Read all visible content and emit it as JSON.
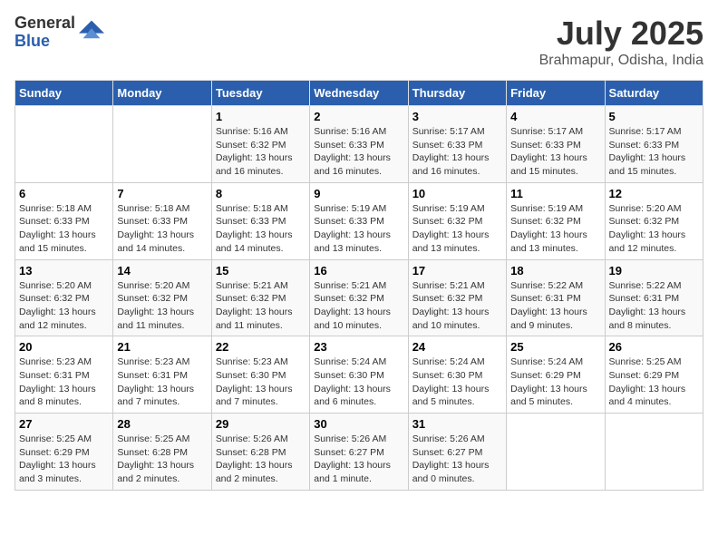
{
  "logo": {
    "general": "General",
    "blue": "Blue"
  },
  "title": "July 2025",
  "location": "Brahmapur, Odisha, India",
  "weekdays": [
    "Sunday",
    "Monday",
    "Tuesday",
    "Wednesday",
    "Thursday",
    "Friday",
    "Saturday"
  ],
  "weeks": [
    [
      {
        "day": null,
        "detail": null
      },
      {
        "day": null,
        "detail": null
      },
      {
        "day": "1",
        "sunrise": "5:16 AM",
        "sunset": "6:32 PM",
        "daylight": "13 hours and 16 minutes."
      },
      {
        "day": "2",
        "sunrise": "5:16 AM",
        "sunset": "6:33 PM",
        "daylight": "13 hours and 16 minutes."
      },
      {
        "day": "3",
        "sunrise": "5:17 AM",
        "sunset": "6:33 PM",
        "daylight": "13 hours and 16 minutes."
      },
      {
        "day": "4",
        "sunrise": "5:17 AM",
        "sunset": "6:33 PM",
        "daylight": "13 hours and 15 minutes."
      },
      {
        "day": "5",
        "sunrise": "5:17 AM",
        "sunset": "6:33 PM",
        "daylight": "13 hours and 15 minutes."
      }
    ],
    [
      {
        "day": "6",
        "sunrise": "5:18 AM",
        "sunset": "6:33 PM",
        "daylight": "13 hours and 15 minutes."
      },
      {
        "day": "7",
        "sunrise": "5:18 AM",
        "sunset": "6:33 PM",
        "daylight": "13 hours and 14 minutes."
      },
      {
        "day": "8",
        "sunrise": "5:18 AM",
        "sunset": "6:33 PM",
        "daylight": "13 hours and 14 minutes."
      },
      {
        "day": "9",
        "sunrise": "5:19 AM",
        "sunset": "6:33 PM",
        "daylight": "13 hours and 13 minutes."
      },
      {
        "day": "10",
        "sunrise": "5:19 AM",
        "sunset": "6:32 PM",
        "daylight": "13 hours and 13 minutes."
      },
      {
        "day": "11",
        "sunrise": "5:19 AM",
        "sunset": "6:32 PM",
        "daylight": "13 hours and 13 minutes."
      },
      {
        "day": "12",
        "sunrise": "5:20 AM",
        "sunset": "6:32 PM",
        "daylight": "13 hours and 12 minutes."
      }
    ],
    [
      {
        "day": "13",
        "sunrise": "5:20 AM",
        "sunset": "6:32 PM",
        "daylight": "13 hours and 12 minutes."
      },
      {
        "day": "14",
        "sunrise": "5:20 AM",
        "sunset": "6:32 PM",
        "daylight": "13 hours and 11 minutes."
      },
      {
        "day": "15",
        "sunrise": "5:21 AM",
        "sunset": "6:32 PM",
        "daylight": "13 hours and 11 minutes."
      },
      {
        "day": "16",
        "sunrise": "5:21 AM",
        "sunset": "6:32 PM",
        "daylight": "13 hours and 10 minutes."
      },
      {
        "day": "17",
        "sunrise": "5:21 AM",
        "sunset": "6:32 PM",
        "daylight": "13 hours and 10 minutes."
      },
      {
        "day": "18",
        "sunrise": "5:22 AM",
        "sunset": "6:31 PM",
        "daylight": "13 hours and 9 minutes."
      },
      {
        "day": "19",
        "sunrise": "5:22 AM",
        "sunset": "6:31 PM",
        "daylight": "13 hours and 8 minutes."
      }
    ],
    [
      {
        "day": "20",
        "sunrise": "5:23 AM",
        "sunset": "6:31 PM",
        "daylight": "13 hours and 8 minutes."
      },
      {
        "day": "21",
        "sunrise": "5:23 AM",
        "sunset": "6:31 PM",
        "daylight": "13 hours and 7 minutes."
      },
      {
        "day": "22",
        "sunrise": "5:23 AM",
        "sunset": "6:30 PM",
        "daylight": "13 hours and 7 minutes."
      },
      {
        "day": "23",
        "sunrise": "5:24 AM",
        "sunset": "6:30 PM",
        "daylight": "13 hours and 6 minutes."
      },
      {
        "day": "24",
        "sunrise": "5:24 AM",
        "sunset": "6:30 PM",
        "daylight": "13 hours and 5 minutes."
      },
      {
        "day": "25",
        "sunrise": "5:24 AM",
        "sunset": "6:29 PM",
        "daylight": "13 hours and 5 minutes."
      },
      {
        "day": "26",
        "sunrise": "5:25 AM",
        "sunset": "6:29 PM",
        "daylight": "13 hours and 4 minutes."
      }
    ],
    [
      {
        "day": "27",
        "sunrise": "5:25 AM",
        "sunset": "6:29 PM",
        "daylight": "13 hours and 3 minutes."
      },
      {
        "day": "28",
        "sunrise": "5:25 AM",
        "sunset": "6:28 PM",
        "daylight": "13 hours and 2 minutes."
      },
      {
        "day": "29",
        "sunrise": "5:26 AM",
        "sunset": "6:28 PM",
        "daylight": "13 hours and 2 minutes."
      },
      {
        "day": "30",
        "sunrise": "5:26 AM",
        "sunset": "6:27 PM",
        "daylight": "13 hours and 1 minute."
      },
      {
        "day": "31",
        "sunrise": "5:26 AM",
        "sunset": "6:27 PM",
        "daylight": "13 hours and 0 minutes."
      },
      {
        "day": null,
        "detail": null
      },
      {
        "day": null,
        "detail": null
      }
    ]
  ],
  "colors": {
    "header_bg": "#2b5fad",
    "header_text": "#ffffff",
    "odd_row": "#f9f9f9",
    "even_row": "#ffffff"
  }
}
